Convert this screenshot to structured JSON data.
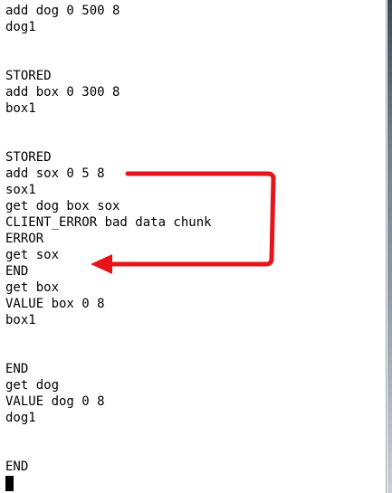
{
  "terminal": {
    "lines": [
      "add dog 0 500 8",
      "dog1",
      "",
      "",
      "STORED",
      "add box 0 300 8",
      "box1",
      "",
      "",
      "STORED",
      "add sox 0 5 8",
      "sox1",
      "get dog box sox",
      "CLIENT_ERROR bad data chunk",
      "ERROR",
      "get sox",
      "END",
      "get box",
      "VALUE box 0 8",
      "box1",
      "",
      "",
      "END",
      "get dog",
      "VALUE dog 0 8",
      "dog1",
      "",
      "",
      "END"
    ]
  },
  "annotation": {
    "color": "#e8141b"
  }
}
